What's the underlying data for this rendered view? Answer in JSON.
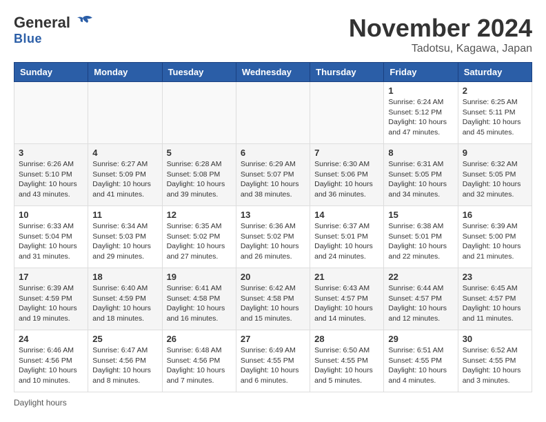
{
  "logo": {
    "general": "General",
    "blue": "Blue"
  },
  "header": {
    "month": "November 2024",
    "location": "Tadotsu, Kagawa, Japan"
  },
  "days_of_week": [
    "Sunday",
    "Monday",
    "Tuesday",
    "Wednesday",
    "Thursday",
    "Friday",
    "Saturday"
  ],
  "footer": {
    "note": "Daylight hours"
  },
  "weeks": [
    [
      {
        "day": "",
        "info": ""
      },
      {
        "day": "",
        "info": ""
      },
      {
        "day": "",
        "info": ""
      },
      {
        "day": "",
        "info": ""
      },
      {
        "day": "",
        "info": ""
      },
      {
        "day": "1",
        "info": "Sunrise: 6:24 AM\nSunset: 5:12 PM\nDaylight: 10 hours\nand 47 minutes."
      },
      {
        "day": "2",
        "info": "Sunrise: 6:25 AM\nSunset: 5:11 PM\nDaylight: 10 hours\nand 45 minutes."
      }
    ],
    [
      {
        "day": "3",
        "info": "Sunrise: 6:26 AM\nSunset: 5:10 PM\nDaylight: 10 hours\nand 43 minutes."
      },
      {
        "day": "4",
        "info": "Sunrise: 6:27 AM\nSunset: 5:09 PM\nDaylight: 10 hours\nand 41 minutes."
      },
      {
        "day": "5",
        "info": "Sunrise: 6:28 AM\nSunset: 5:08 PM\nDaylight: 10 hours\nand 39 minutes."
      },
      {
        "day": "6",
        "info": "Sunrise: 6:29 AM\nSunset: 5:07 PM\nDaylight: 10 hours\nand 38 minutes."
      },
      {
        "day": "7",
        "info": "Sunrise: 6:30 AM\nSunset: 5:06 PM\nDaylight: 10 hours\nand 36 minutes."
      },
      {
        "day": "8",
        "info": "Sunrise: 6:31 AM\nSunset: 5:05 PM\nDaylight: 10 hours\nand 34 minutes."
      },
      {
        "day": "9",
        "info": "Sunrise: 6:32 AM\nSunset: 5:05 PM\nDaylight: 10 hours\nand 32 minutes."
      }
    ],
    [
      {
        "day": "10",
        "info": "Sunrise: 6:33 AM\nSunset: 5:04 PM\nDaylight: 10 hours\nand 31 minutes."
      },
      {
        "day": "11",
        "info": "Sunrise: 6:34 AM\nSunset: 5:03 PM\nDaylight: 10 hours\nand 29 minutes."
      },
      {
        "day": "12",
        "info": "Sunrise: 6:35 AM\nSunset: 5:02 PM\nDaylight: 10 hours\nand 27 minutes."
      },
      {
        "day": "13",
        "info": "Sunrise: 6:36 AM\nSunset: 5:02 PM\nDaylight: 10 hours\nand 26 minutes."
      },
      {
        "day": "14",
        "info": "Sunrise: 6:37 AM\nSunset: 5:01 PM\nDaylight: 10 hours\nand 24 minutes."
      },
      {
        "day": "15",
        "info": "Sunrise: 6:38 AM\nSunset: 5:01 PM\nDaylight: 10 hours\nand 22 minutes."
      },
      {
        "day": "16",
        "info": "Sunrise: 6:39 AM\nSunset: 5:00 PM\nDaylight: 10 hours\nand 21 minutes."
      }
    ],
    [
      {
        "day": "17",
        "info": "Sunrise: 6:39 AM\nSunset: 4:59 PM\nDaylight: 10 hours\nand 19 minutes."
      },
      {
        "day": "18",
        "info": "Sunrise: 6:40 AM\nSunset: 4:59 PM\nDaylight: 10 hours\nand 18 minutes."
      },
      {
        "day": "19",
        "info": "Sunrise: 6:41 AM\nSunset: 4:58 PM\nDaylight: 10 hours\nand 16 minutes."
      },
      {
        "day": "20",
        "info": "Sunrise: 6:42 AM\nSunset: 4:58 PM\nDaylight: 10 hours\nand 15 minutes."
      },
      {
        "day": "21",
        "info": "Sunrise: 6:43 AM\nSunset: 4:57 PM\nDaylight: 10 hours\nand 14 minutes."
      },
      {
        "day": "22",
        "info": "Sunrise: 6:44 AM\nSunset: 4:57 PM\nDaylight: 10 hours\nand 12 minutes."
      },
      {
        "day": "23",
        "info": "Sunrise: 6:45 AM\nSunset: 4:57 PM\nDaylight: 10 hours\nand 11 minutes."
      }
    ],
    [
      {
        "day": "24",
        "info": "Sunrise: 6:46 AM\nSunset: 4:56 PM\nDaylight: 10 hours\nand 10 minutes."
      },
      {
        "day": "25",
        "info": "Sunrise: 6:47 AM\nSunset: 4:56 PM\nDaylight: 10 hours\nand 8 minutes."
      },
      {
        "day": "26",
        "info": "Sunrise: 6:48 AM\nSunset: 4:56 PM\nDaylight: 10 hours\nand 7 minutes."
      },
      {
        "day": "27",
        "info": "Sunrise: 6:49 AM\nSunset: 4:55 PM\nDaylight: 10 hours\nand 6 minutes."
      },
      {
        "day": "28",
        "info": "Sunrise: 6:50 AM\nSunset: 4:55 PM\nDaylight: 10 hours\nand 5 minutes."
      },
      {
        "day": "29",
        "info": "Sunrise: 6:51 AM\nSunset: 4:55 PM\nDaylight: 10 hours\nand 4 minutes."
      },
      {
        "day": "30",
        "info": "Sunrise: 6:52 AM\nSunset: 4:55 PM\nDaylight: 10 hours\nand 3 minutes."
      }
    ]
  ]
}
